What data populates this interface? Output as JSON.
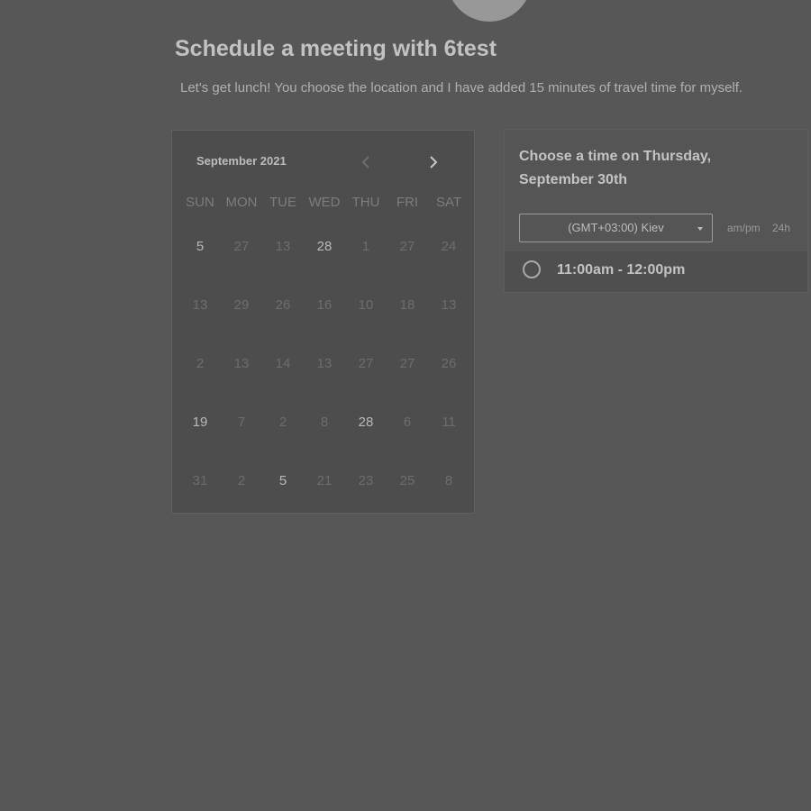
{
  "header": {
    "title": "Schedule a meeting with 6test",
    "subtitle": "Let's get lunch! You choose the location and I have added 15 minutes of travel time for myself."
  },
  "calendar": {
    "month_label": "September 2021",
    "prev_icon": "chevron-left-icon",
    "next_icon": "chevron-right-icon",
    "weekdays": [
      "SUN",
      "MON",
      "TUE",
      "WED",
      "THU",
      "FRI",
      "SAT"
    ],
    "weeks": [
      [
        "5",
        "27",
        "13",
        "28",
        "1",
        "27",
        "24"
      ],
      [
        "13",
        "29",
        "26",
        "16",
        "10",
        "18",
        "13"
      ],
      [
        "2",
        "13",
        "14",
        "13",
        "27",
        "27",
        "26"
      ],
      [
        "19",
        "7",
        "2",
        "8",
        "28",
        "6",
        "11"
      ],
      [
        "31",
        "2",
        "5",
        "21",
        "23",
        "25",
        "8"
      ]
    ],
    "active_days": [
      [
        0,
        0
      ],
      [
        0,
        3
      ],
      [
        3,
        0
      ],
      [
        3,
        4
      ],
      [
        4,
        2
      ]
    ]
  },
  "time_panel": {
    "title": "Choose a time on Thursday, September 30th",
    "timezone": "(GMT+03:00) Kiev",
    "format_12": "am/pm",
    "format_24": "24h",
    "slots": [
      {
        "label": "11:00am - 12:00pm"
      }
    ]
  },
  "colors": {
    "background": "#575757",
    "calendar_bg": "#4d4d4d"
  }
}
